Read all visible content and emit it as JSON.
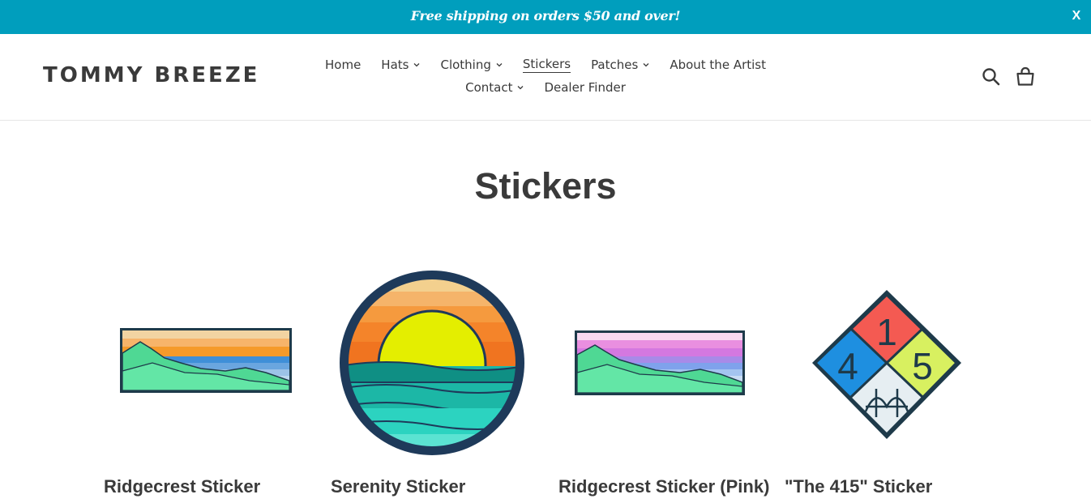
{
  "announcement": {
    "text": "Free shipping on orders $50 and over!",
    "close_label": "X"
  },
  "header": {
    "logo": "TOMMY BREEZE",
    "nav_row1": [
      {
        "label": "Home",
        "dropdown": false,
        "active": false
      },
      {
        "label": "Hats",
        "dropdown": true,
        "active": false
      },
      {
        "label": "Clothing",
        "dropdown": true,
        "active": false
      },
      {
        "label": "Stickers",
        "dropdown": false,
        "active": true
      },
      {
        "label": "Patches",
        "dropdown": true,
        "active": false
      },
      {
        "label": "About the Artist",
        "dropdown": false,
        "active": false
      }
    ],
    "nav_row2": [
      {
        "label": "Contact",
        "dropdown": true,
        "active": false
      },
      {
        "label": "Dealer Finder",
        "dropdown": false,
        "active": false
      }
    ],
    "icons": [
      "search-icon",
      "cart-icon"
    ]
  },
  "page": {
    "title": "Stickers"
  },
  "products": [
    {
      "title": "Ridgecrest Sticker",
      "image": "ridgecrest-sunset-image"
    },
    {
      "title": "Serenity Sticker",
      "image": "serenity-sun-image"
    },
    {
      "title": "Ridgecrest Sticker (Pink)",
      "image": "ridgecrest-pink-image"
    },
    {
      "title": "\"The 415\" Sticker",
      "image": "415-diamond-image"
    }
  ],
  "colors": {
    "announcement_bg": "#009ebd",
    "text": "#3a3a3a"
  }
}
